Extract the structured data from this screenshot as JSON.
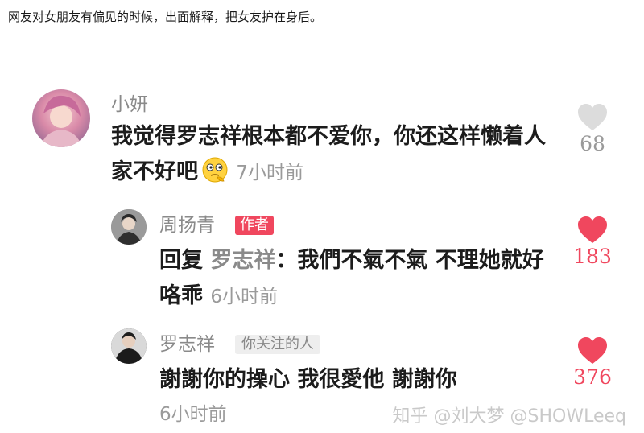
{
  "caption": "网友对女朋友有偏见的时候，出面解释，把女友护在身后。",
  "comments": [
    {
      "username": "小妍",
      "text": "我觉得罗志祥根本都不爱你，你还这样懒着人家不好吧",
      "time": "7小时前",
      "likes": "68",
      "liked": false,
      "emoji": "thinking-face"
    },
    {
      "username": "周扬青",
      "badge": "作者",
      "reply_prefix": "回复",
      "reply_to": "罗志祥",
      "reply_sep": "：",
      "text": "我們不氣不氣 不理她就好咯乖",
      "time": "6小时前",
      "likes": "183",
      "liked": true
    },
    {
      "username": "罗志祥",
      "badge": "你关注的人",
      "text": "謝謝你的操心 我很愛他 謝謝你",
      "time": "6小时前",
      "likes": "376",
      "liked": true
    }
  ],
  "colors": {
    "liked": "#f0475e",
    "unliked": "#d9d9d9",
    "count_unliked": "#9a9a9a"
  },
  "watermark": "知乎 @刘大梦 @SHOWLeeq"
}
